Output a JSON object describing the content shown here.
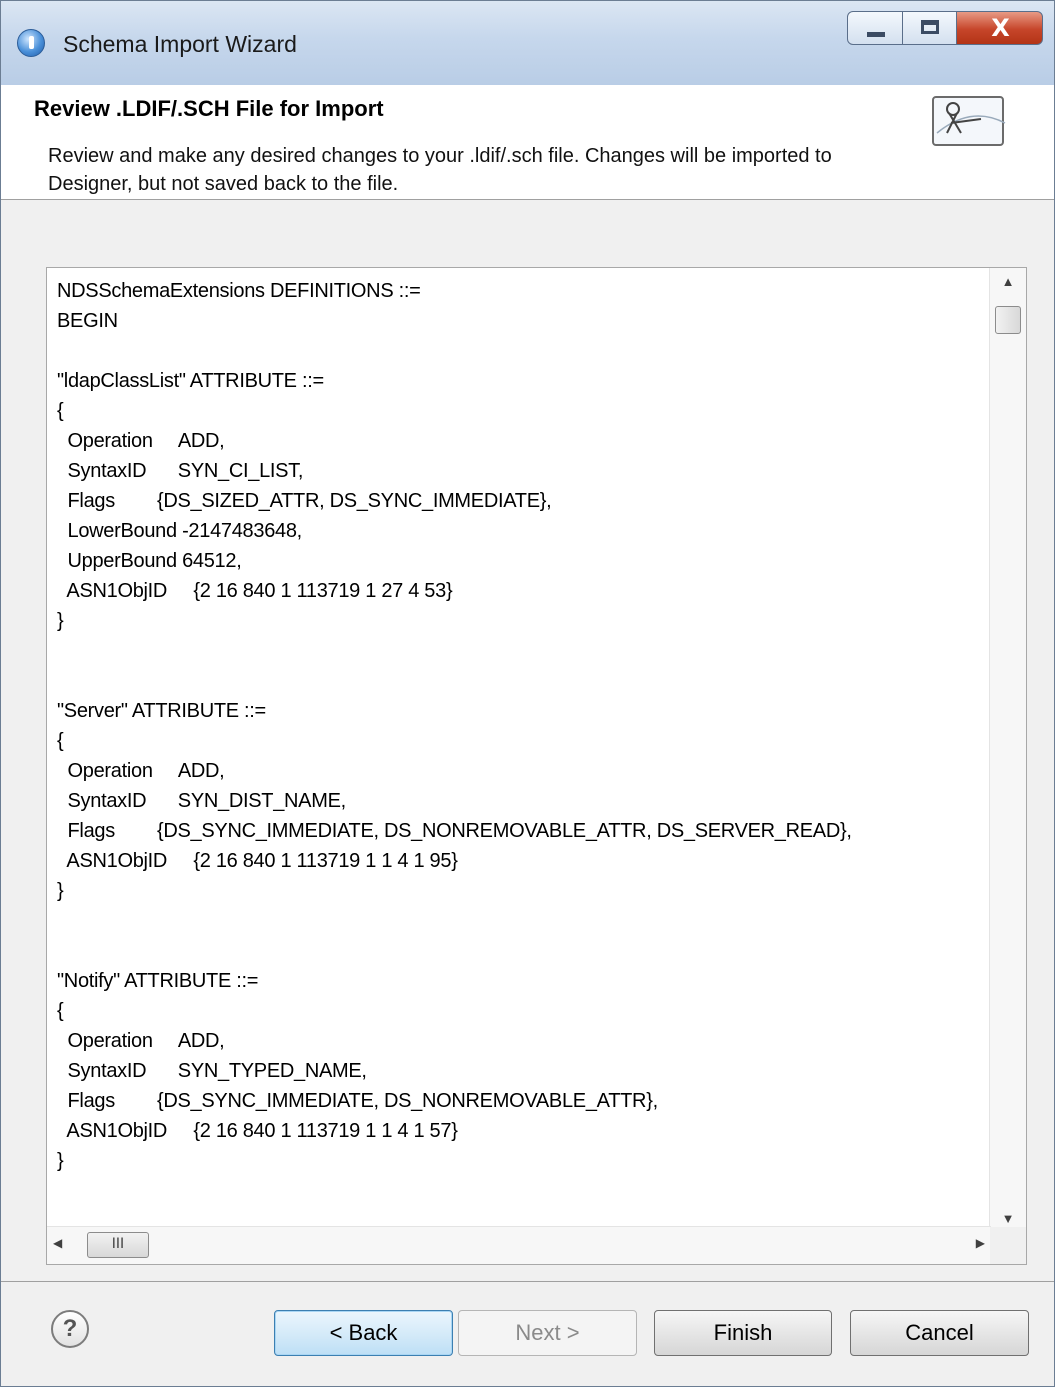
{
  "window": {
    "title": "Schema Import Wizard",
    "controls": {
      "minimize": "—",
      "maximize": "□",
      "close": "X"
    }
  },
  "header": {
    "title": "Review .LDIF/.SCH File for Import",
    "description": "Review and make any desired changes to your .ldif/.sch file.  Changes will be imported to Designer, but not saved back to the file."
  },
  "editor": {
    "content": "NDSSchemaExtensions DEFINITIONS ::=\nBEGIN\n\n\"ldapClassList\" ATTRIBUTE ::=\n{\n  Operation     ADD,\n  SyntaxID      SYN_CI_LIST,\n  Flags        {DS_SIZED_ATTR, DS_SYNC_IMMEDIATE},\n  LowerBound -2147483648,\n  UpperBound 64512,\n  ASN1ObjID     {2 16 840 1 113719 1 27 4 53}\n}\n\n\n\"Server\" ATTRIBUTE ::=\n{\n  Operation     ADD,\n  SyntaxID      SYN_DIST_NAME,\n  Flags        {DS_SYNC_IMMEDIATE, DS_NONREMOVABLE_ATTR, DS_SERVER_READ},\n  ASN1ObjID     {2 16 840 1 113719 1 1 4 1 95}\n}\n\n\n\"Notify\" ATTRIBUTE ::=\n{\n  Operation     ADD,\n  SyntaxID      SYN_TYPED_NAME,\n  Flags        {DS_SYNC_IMMEDIATE, DS_NONREMOVABLE_ATTR},\n  ASN1ObjID     {2 16 840 1 113719 1 1 4 1 57}\n}",
    "scroll_arrows": {
      "up": "▲",
      "down": "▼",
      "left": "◀",
      "right": "▶"
    },
    "hscroll_thumb_grip": "III"
  },
  "footer": {
    "help": "?",
    "back": "< Back",
    "next": "Next >",
    "finish": "Finish",
    "cancel": "Cancel"
  }
}
